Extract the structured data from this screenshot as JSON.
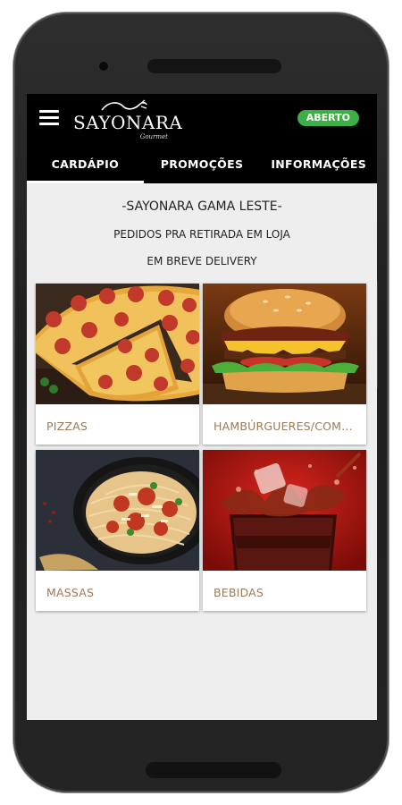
{
  "app": {
    "brand_name": "SAYONARA",
    "brand_sub": "Gourmet",
    "status_badge": "ABERTO"
  },
  "tabs": [
    {
      "label": "CARDÁPIO"
    },
    {
      "label": "PROMOÇÕES"
    },
    {
      "label": "INFORMAÇÕES"
    }
  ],
  "info": {
    "title": "-SAYONARA GAMA LESTE-",
    "line1": "PEDIDOS PRA RETIRADA EM LOJA",
    "line2": "EM BREVE DELIVERY"
  },
  "categories": [
    {
      "label": "PIZZAS",
      "icon": "pizza-image"
    },
    {
      "label": "HAMBÚRGUERES/COMBOS",
      "icon": "burger-image"
    },
    {
      "label": "MASSAS",
      "icon": "pasta-image"
    },
    {
      "label": "BEBIDAS",
      "icon": "drink-image"
    }
  ],
  "colors": {
    "appbar": "#000000",
    "badge": "#3cb044",
    "label": "#9a7a5a",
    "background": "#eeeeee"
  }
}
